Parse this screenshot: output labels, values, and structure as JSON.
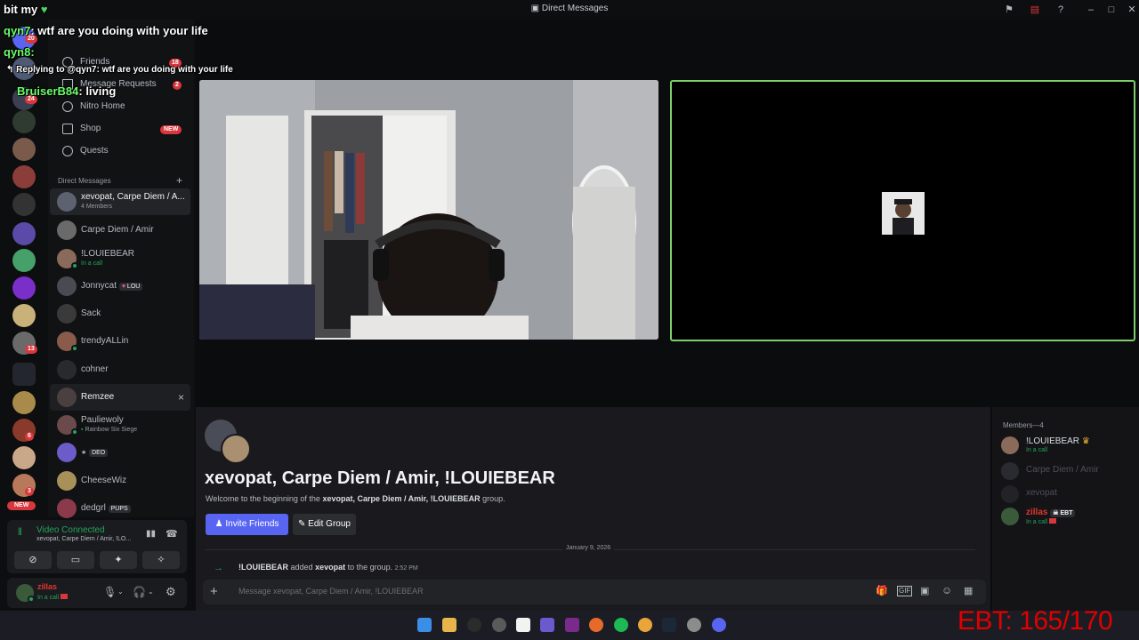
{
  "window": {
    "title": "Direct Messages"
  },
  "overlay": {
    "streamer": "bit my",
    "heart": "♥",
    "chat_line1_user": "qyn7",
    "chat_line1_text": ": wtf are you doing with your life",
    "chat_line2_user": "qyn8:",
    "reply_prefix": "Replying to @qyn7: wtf are you doing with your life",
    "chat_line3_user": "BruiserB84",
    "chat_line3_text": ": living",
    "counter": "EBT: 165/170"
  },
  "guilds": {
    "badges": [
      "20",
      "24",
      "6",
      "13",
      "6",
      "3"
    ],
    "new_label": "NEW"
  },
  "sidebar": {
    "nav": [
      {
        "label": "Friends",
        "badge": "18"
      },
      {
        "label": "Message Requests",
        "badge": "2"
      },
      {
        "label": "Nitro Home"
      },
      {
        "label": "Shop",
        "badge": "NEW"
      },
      {
        "label": "Quests"
      }
    ],
    "dm_header": "Direct Messages",
    "add_dm": "+",
    "dms": [
      {
        "name": "xevopat, Carpe Diem / A...",
        "sub": "4 Members"
      },
      {
        "name": "Carpe Diem / Amir",
        "sub": ""
      },
      {
        "name": "!LOUIEBEAR",
        "sub": "In a call"
      },
      {
        "name": "Jonnycat",
        "tag": "LOU"
      },
      {
        "name": "Sack"
      },
      {
        "name": "trendyALLin"
      },
      {
        "name": "cohner"
      },
      {
        "name": "Remzee",
        "close": "×"
      },
      {
        "name": "Pauliewoly",
        "sub": "Rainbow Six Siege"
      },
      {
        "name": "★",
        "tag": "DEO"
      },
      {
        "name": "CheeseWiz"
      },
      {
        "name": "dedgrl",
        "tag": "PUPS"
      }
    ]
  },
  "voice": {
    "status": "Video Connected",
    "channel": "xevopat, Carpe Diem / Amir, !LO..."
  },
  "user": {
    "name": "zillas",
    "status": "In a call"
  },
  "chat": {
    "group_title": "xevopat, Carpe Diem / Amir, !LOUIEBEAR",
    "welcome_prefix": "Welcome to the beginning of the",
    "welcome_bold": "xevopat, Carpe Diem / Amir, !LOUIEBEAR",
    "welcome_suffix": "group.",
    "invite_label": "Invite Friends",
    "edit_label": "Edit Group",
    "date_divider": "January 9, 2026",
    "event_actor": "!LOUIEBEAR",
    "event_verb": "added",
    "event_target": "xevopat",
    "event_suffix": "to the group.",
    "event_time": "2:52 PM",
    "input_placeholder": "Message xevopat, Carpe Diem / Amir, !LOUIEBEAR"
  },
  "members": {
    "header": "Members—4",
    "list": [
      {
        "name": "!LOUIEBEAR",
        "sub": "In a call",
        "color": "#dbdee1"
      },
      {
        "name": "Carpe Diem / Amir",
        "sub": "",
        "color": "#4e5058"
      },
      {
        "name": "xevopat",
        "sub": "",
        "color": "#4e5058"
      },
      {
        "name": "zillas",
        "tag": "EBT",
        "sub": "In a call",
        "color": "#e0362f"
      }
    ]
  },
  "colors": {
    "accent": "#5865f2",
    "online": "#23a55a",
    "danger": "#da373c",
    "video_border": "#7ccf6a"
  }
}
